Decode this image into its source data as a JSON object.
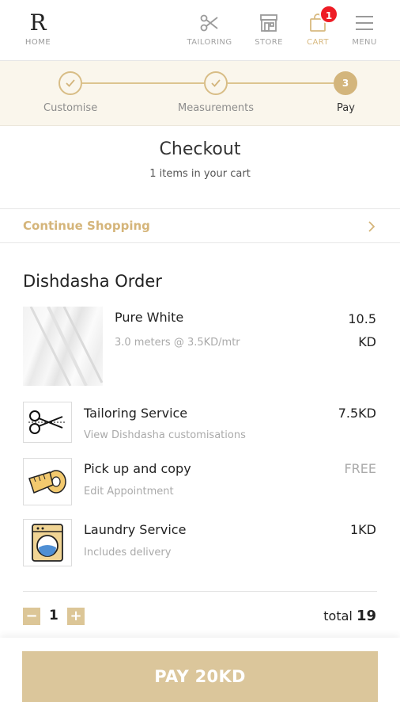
{
  "nav": {
    "logo_mark": "R",
    "home_label": "HOME",
    "tailoring_label": "TAILORING",
    "store_label": "STORE",
    "cart_label": "CART",
    "cart_count": "1",
    "menu_label": "MENU"
  },
  "progress": {
    "steps": [
      {
        "label": "Customise",
        "state": "done"
      },
      {
        "label": "Measurements",
        "state": "done"
      },
      {
        "label": "Pay",
        "number": "3",
        "state": "current"
      }
    ]
  },
  "checkout": {
    "title": "Checkout",
    "subtitle": "1 items in your cart",
    "continue_label": "Continue Shopping"
  },
  "order": {
    "title": "Dishdasha Order",
    "fabric": {
      "name": "Pure White",
      "detail": "3.0 meters @ 3.5KD/mtr",
      "price_amount": "10.5",
      "price_currency": "KD"
    },
    "services": [
      {
        "icon": "scissors-icon",
        "name": "Tailoring Service",
        "detail": "View Dishdasha customisations",
        "price": "7.5KD"
      },
      {
        "icon": "measuring-tape-icon",
        "name": "Pick up and copy",
        "detail": "Edit Appointment",
        "price": "FREE"
      },
      {
        "icon": "washing-machine-icon",
        "name": "Laundry Service",
        "detail": "Includes delivery",
        "price": "1KD"
      }
    ]
  },
  "quantity": {
    "minus": "−",
    "value": "1",
    "plus": "+"
  },
  "total": {
    "label": "total",
    "value": "19"
  },
  "pay_button": "PAY 20KD",
  "colors": {
    "accent": "#d8b980",
    "badge": "#ee1c25",
    "progress_bg": "#faf6ec",
    "pay_button": "#dbc69b"
  }
}
